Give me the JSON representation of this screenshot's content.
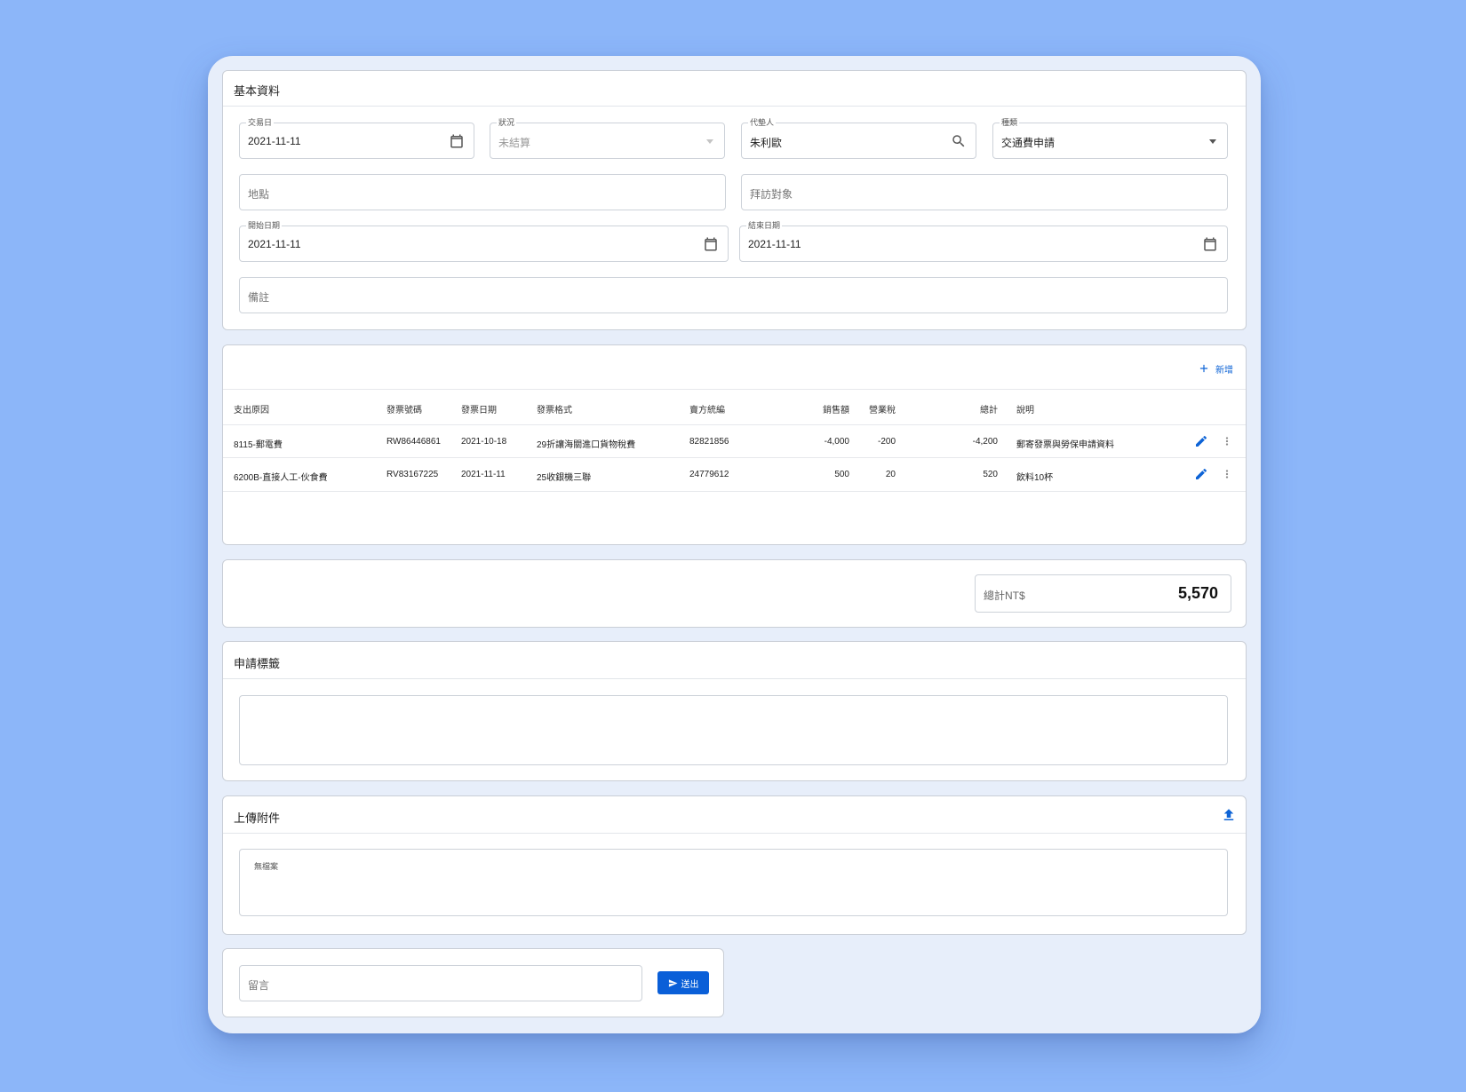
{
  "basic_info": {
    "title": "基本資料",
    "transaction_date": {
      "label": "交易日",
      "value": "2021-11-11"
    },
    "status": {
      "label": "狀況",
      "value": "未結算"
    },
    "agent": {
      "label": "代墊人",
      "value": "朱利歐"
    },
    "category": {
      "label": "種類",
      "value": "交通費申請"
    },
    "location": {
      "placeholder": "地點"
    },
    "visit_target": {
      "placeholder": "拜訪對象"
    },
    "start_date": {
      "label": "開始日期",
      "value": "2021-11-11"
    },
    "end_date": {
      "label": "結束日期",
      "value": "2021-11-11"
    },
    "remarks": {
      "placeholder": "備註"
    }
  },
  "expenses": {
    "add_label": "新增",
    "columns": [
      "支出原因",
      "發票號碼",
      "發票日期",
      "發票格式",
      "賣方統編",
      "銷售額",
      "營業稅",
      "總計",
      "說明"
    ],
    "rows": [
      {
        "reason": "8115-郵電費",
        "invoice_no": "RW86446861",
        "invoice_date": "2021-10-18",
        "format": "29折讓海關進口貨物稅費",
        "seller_id": "82821856",
        "sales": "-4,000",
        "tax": "-200",
        "total": "-4,200",
        "note": "郵寄發票與勞保申請資料"
      },
      {
        "reason": "6200B-直接人工-伙食費",
        "invoice_no": "RV83167225",
        "invoice_date": "2021-11-11",
        "format": "25收銀機三聯",
        "seller_id": "24779612",
        "sales": "500",
        "tax": "20",
        "total": "520",
        "note": "飲料10杯"
      }
    ]
  },
  "summary": {
    "total_label": "總計NT$",
    "total_value": "5,570"
  },
  "tags": {
    "title": "申請標籤"
  },
  "attachments": {
    "title": "上傳附件",
    "empty_text": "無檔案"
  },
  "comment": {
    "placeholder": "留言",
    "send_label": "送出"
  },
  "colors": {
    "accent": "#0a5fd8",
    "background": "#8cb6f9",
    "window": "#e7eefa"
  }
}
